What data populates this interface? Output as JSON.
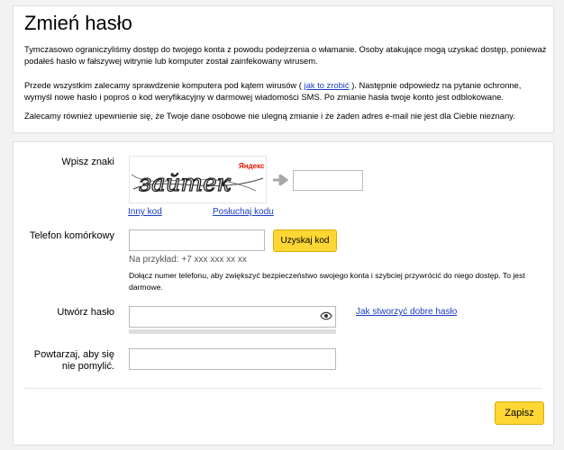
{
  "header": {
    "title": "Zmień hasło",
    "para1": "Tymczasowo ograniczyliśmy dostęp do twojego konta z powodu podejrzenia o włamanie. Osoby atakujące mogą uzyskać dostęp, ponieważ podałeś hasło w fałszywej witrynie lub komputer został zainfekowany wirusem.",
    "para2_before": "Przede wszystkim zalecamy sprawdzenie komputera pod kątem wirusów (",
    "para2_link": "jak to zrobić",
    "para2_after": "). Następnie odpowiedz na pytanie ochronne, wymyśl nowe hasło i poproś o kod weryfikacyjny w darmowej wiadomości SMS. Po zmianie hasła twoje konto jest odblokowane.",
    "para3": "Zalecamy również upewnienie się, że Twoje dane osobowe nie ulegną zmianie i że żaden adres e-mail nie jest dla Ciebie nieznany."
  },
  "form": {
    "captcha_label": "Wpisz znaki",
    "captcha_text": "зайтек",
    "captcha_brand": "Яндекс",
    "captcha_input": {
      "value": "",
      "placeholder": ""
    },
    "other_code_link": "Inny kod",
    "listen_code_link": "Posłuchaj kodu",
    "phone_label": "Telefon komórkowy",
    "phone_input": {
      "value": "",
      "placeholder": ""
    },
    "get_code_button": "Uzyskaj kod",
    "phone_example": "Na przykład: +7 xxx xxx xx xx",
    "phone_note": "Dołącz numer telefonu, aby zwiększyć bezpieczeństwo swojego konta i szybciej przywrócić do niego dostęp. To jest darmowe.",
    "password_label": "Utwórz hasło",
    "password_input": {
      "value": "",
      "placeholder": ""
    },
    "password_help_link": "Jak stworzyć dobre hasło",
    "repeat_label_line1": "Powtarzaj, aby się",
    "repeat_label_line2": "nie pomylić.",
    "repeat_input": {
      "value": "",
      "placeholder": ""
    },
    "save_button": "Zapisz"
  },
  "colors": {
    "link": "#1a3dc1",
    "button": "#ffd633",
    "brand_red": "#e61400"
  },
  "icons": [
    "arrow-right-icon",
    "eye-icon"
  ]
}
